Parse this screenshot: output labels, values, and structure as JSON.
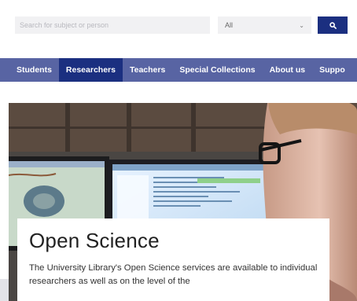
{
  "search": {
    "placeholder": "Search for subject or person",
    "scope_value": "All"
  },
  "nav": {
    "items": [
      {
        "label": "Students",
        "active": false
      },
      {
        "label": "Researchers",
        "active": true
      },
      {
        "label": "Teachers",
        "active": false
      },
      {
        "label": "Special Collections",
        "active": false
      },
      {
        "label": "About us",
        "active": false
      },
      {
        "label": "Suppo",
        "active": false
      }
    ]
  },
  "hero": {
    "title": "Open Science",
    "text": "The University Library's Open Science services are available to individual researchers as well as on the level of the"
  },
  "colors": {
    "brand_dark": "#1b2f80",
    "nav_background": "#5864a3"
  }
}
